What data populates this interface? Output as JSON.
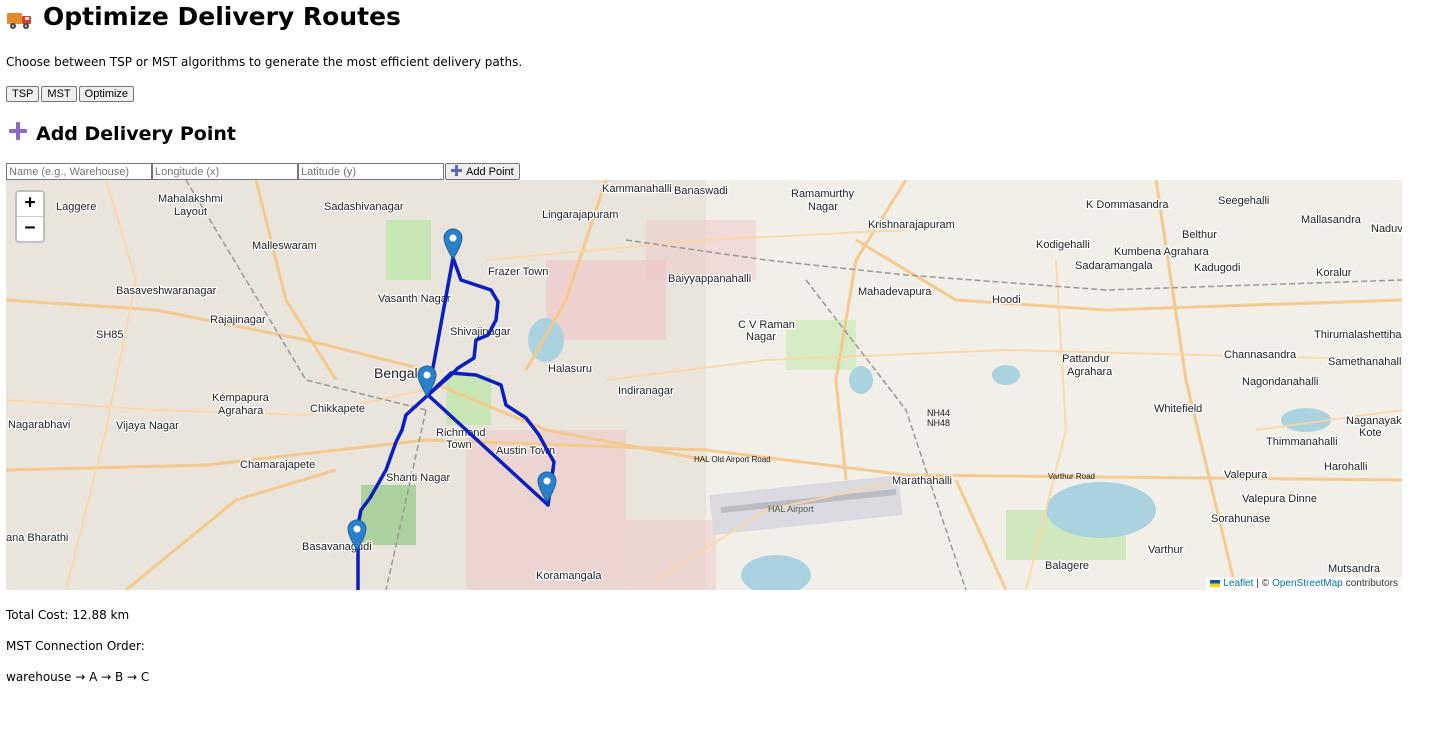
{
  "header": {
    "title": "Optimize Delivery Routes",
    "description": "Choose between TSP or MST algorithms to generate the most efficient delivery paths."
  },
  "toolbar": {
    "tsp_label": "TSP",
    "mst_label": "MST",
    "optimize_label": "Optimize"
  },
  "add_point": {
    "title": "Add Delivery Point",
    "name_placeholder": "Name (e.g., Warehouse)",
    "lon_placeholder": "Longitude (x)",
    "lat_placeholder": "Latitude (y)",
    "add_label": "Add Point"
  },
  "map": {
    "zoom_in": "+",
    "zoom_out": "−",
    "attribution_leaflet": "Leaflet",
    "attribution_sep": "| ©",
    "attribution_osm": "OpenStreetMap",
    "attribution_tail": "contributors",
    "route_color": "#0b1fbf",
    "marker_color": "#2a81cb",
    "labels": {
      "mahalakshmi": "Mahalakshmi",
      "layout": "Layout",
      "laggere": "Laggere",
      "sadashivanagar": "Sadashivanagar",
      "kammanahalli": "Kammanahalli",
      "banaswadi": "Banaswadi",
      "ramamurthy": "Ramamurthy",
      "nagar": "Nagar",
      "k_dommasandra": "K Dommasandra",
      "seegehalli": "Seegehalli",
      "mallasandra": "Mallasandra",
      "naduvathi": "Naduva",
      "malleswaram": "Malleswaram",
      "lingarajapuram": "Lingarajapuram",
      "krishnarajapuram": "Krishnarajapuram",
      "belthur": "Belthur",
      "kodigehalli": "Kodigehalli",
      "kumbena_agrahara": "Kumbena Agrahara",
      "sadaramangala": "Sadaramangala",
      "kadugodi": "Kadugodi",
      "koralur": "Koralur",
      "frazer_town": "Frazer Town",
      "baiyyappanahalli": "Baiyyappanahalli",
      "basaveshwaranagar": "Basaveshwaranagar",
      "vasanth_nagar": "Vasanth Nagar",
      "mahadevapura": "Mahadevapura",
      "hoodi": "Hoodi",
      "rajajinagar": "Rajajinagar",
      "shivajinagar": "Shivajinagar",
      "cv_raman": "C V Raman",
      "cv_nagar": "Nagar",
      "thirumalashettihalli": "Thirumalashettihalli",
      "sh85": "SH85",
      "pattandur": "Pattandur",
      "agrahara": "Agrahara",
      "channasandra": "Channasandra",
      "samethanahalli": "Samethanahalli",
      "bengaluru": "Bengal",
      "halasuru": "Halasuru",
      "indiranagar": "Indiranagar",
      "kempapura": "Kempapura",
      "kempapura_agrahara": "Agrahara",
      "nagondanahalli": "Nagondanahalli",
      "chikkapete": "Chikkapete",
      "whitefield": "Whitefield",
      "nagarabhavi": "Nagarabhavi",
      "vijaya_nagar": "Vijaya Nagar",
      "richmond": "Richmond",
      "town": "Town",
      "austin_town": "Austin Town",
      "nh44": "NH44",
      "nh48": "NH48",
      "naganayaka": "Naganayakan",
      "kote": "Kote",
      "thimmanahalli": "Thimmanahalli",
      "chamarajapete": "Chamarajapete",
      "harohalli": "Harohalli",
      "shanti_nagar": "Shanti Nagar",
      "marathahalli": "Marathahalli",
      "valepura": "Valepura",
      "valepura_dinne": "Valepura Dinne",
      "hal_airport": "HAL Airport",
      "sorahunase": "Sorahunase",
      "ana_bharathi": "ana Bharathi",
      "basavanagudi": "Basavanagudi",
      "varthur": "Varthur",
      "balagere": "Balagere",
      "koramangala": "Koramangala",
      "mutsandra": "Mutsandra",
      "hal_old_airport_road": "HAL Old Airport Road",
      "varthur_road": "Varthur Road"
    }
  },
  "results": {
    "total_cost": "Total Cost: 12.88 km",
    "order_title": "MST Connection Order:",
    "order": "warehouse → A → B → C"
  }
}
